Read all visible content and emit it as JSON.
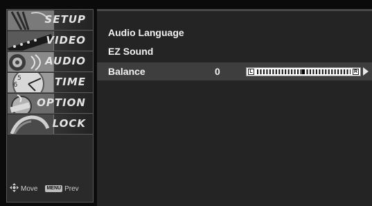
{
  "sidebar": {
    "items": [
      {
        "label": "SETUP",
        "icon": "satellite-dish-icon"
      },
      {
        "label": "VIDEO",
        "icon": "film-reel-icon"
      },
      {
        "label": "AUDIO",
        "icon": "speaker-icon"
      },
      {
        "label": "TIME",
        "icon": "clock-icon"
      },
      {
        "label": "OPTION",
        "icon": "option-dial-icon"
      },
      {
        "label": "LOCK",
        "icon": "padlock-icon"
      }
    ],
    "hints": {
      "move_label": "Move",
      "prev_badge": "MENU",
      "prev_label": "Prev"
    }
  },
  "audio_menu": {
    "rows": [
      {
        "label": "Audio Language"
      },
      {
        "label": "EZ Sound"
      },
      {
        "label": "Balance",
        "value": "0"
      }
    ],
    "balance": {
      "left_cap": "L",
      "right_cap": "R",
      "level": 0.5
    }
  },
  "colors": {
    "background": "#0b0b0b",
    "panel": "#242424",
    "selected_row": "#3e3e3e",
    "text": "#f2f2f2"
  }
}
